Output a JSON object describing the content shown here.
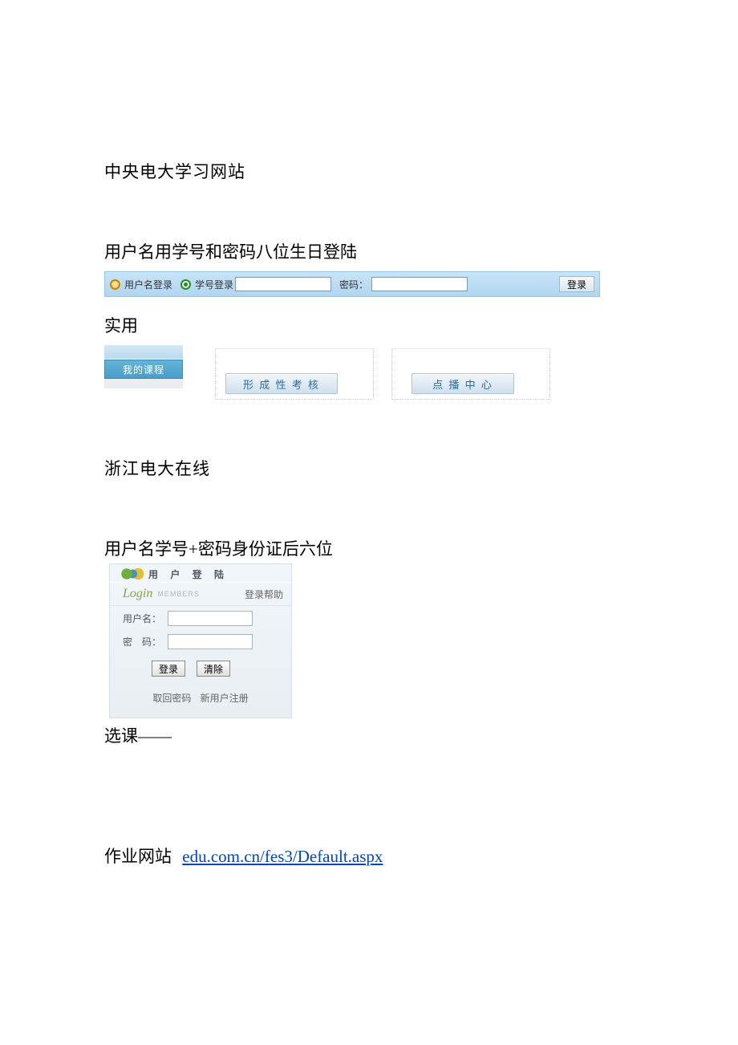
{
  "section1": {
    "title": "中央电大学习网站",
    "subtitle": "用户名用学号和密码八位生日登陆",
    "login_bar": {
      "radio_username": "用户名登录",
      "radio_studentid": "学号登录",
      "password_label": "密码：",
      "login_button": "登录"
    },
    "practical_label": "实用",
    "my_course_tab": "我的课程",
    "button_assessment": "形 成 性 考 核",
    "button_vod": "点 播 中 心"
  },
  "section2": {
    "title": "浙江电大在线",
    "subtitle": "用户名学号+密码身份证后六位",
    "login_box": {
      "header": "用 户 登 陆",
      "login_word": "Login",
      "members": "MEMBERS",
      "help": "登录帮助",
      "username_label": "用户名：",
      "password_label": "密　码：",
      "login_button": "登录",
      "clear_button": "清除",
      "recover_pw": "取回密码",
      "register": "新用户注册"
    },
    "course_select": "选课——"
  },
  "section3": {
    "label": "作业网站",
    "url": "edu.com.cn/fes3/Default.aspx"
  }
}
